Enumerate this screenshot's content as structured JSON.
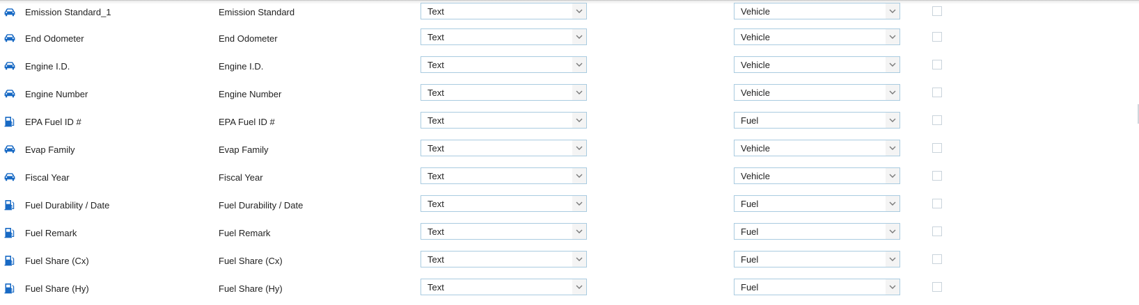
{
  "rows": [
    {
      "icon": "car-icon",
      "name": "Emission Standard_1",
      "label": "Emission Standard",
      "type": "Text",
      "category": "Vehicle"
    },
    {
      "icon": "car-icon",
      "name": "End Odometer",
      "label": "End Odometer",
      "type": "Text",
      "category": "Vehicle"
    },
    {
      "icon": "car-icon",
      "name": "Engine I.D.",
      "label": "Engine I.D.",
      "type": "Text",
      "category": "Vehicle"
    },
    {
      "icon": "car-icon",
      "name": "Engine Number",
      "label": "Engine Number",
      "type": "Text",
      "category": "Vehicle"
    },
    {
      "icon": "fuel-pump-icon",
      "name": "EPA Fuel ID #",
      "label": "EPA Fuel ID #",
      "type": "Text",
      "category": "Fuel"
    },
    {
      "icon": "car-icon",
      "name": "Evap Family",
      "label": "Evap Family",
      "type": "Text",
      "category": "Vehicle"
    },
    {
      "icon": "car-icon",
      "name": "Fiscal Year",
      "label": "Fiscal Year",
      "type": "Text",
      "category": "Vehicle"
    },
    {
      "icon": "fuel-pump-icon",
      "name": "Fuel Durability / Date",
      "label": "Fuel Durability / Date",
      "type": "Text",
      "category": "Fuel"
    },
    {
      "icon": "fuel-pump-icon",
      "name": "Fuel Remark",
      "label": "Fuel Remark",
      "type": "Text",
      "category": "Fuel"
    },
    {
      "icon": "fuel-pump-icon",
      "name": "Fuel Share (Cx)",
      "label": "Fuel Share (Cx)",
      "type": "Text",
      "category": "Fuel"
    },
    {
      "icon": "fuel-pump-icon",
      "name": "Fuel Share (Hy)",
      "label": "Fuel Share (Hy)",
      "type": "Text",
      "category": "Fuel"
    }
  ],
  "colors": {
    "icon": "#1769c4",
    "select_border": "#a9cbe0",
    "arrow": "#7a7a7a",
    "checkbox_border": "#c9d3db"
  }
}
